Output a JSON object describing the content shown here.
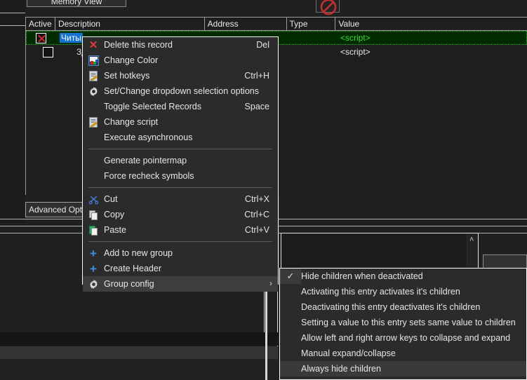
{
  "window": {
    "toolbar": {
      "memory_view_label": "Memory View",
      "stop_icon": "prohibition-icon",
      "grip_icon": "drag-grip-icon"
    },
    "advanced_options_label": "Advanced Opt",
    "scroll_up_glyph": "˄"
  },
  "cheat_table": {
    "columns": [
      "Active",
      "Description",
      "Address",
      "Type",
      "Value"
    ],
    "rows": [
      {
        "active": "x",
        "description": "Читы",
        "description_selected": true,
        "address": "",
        "type": "",
        "value": "<script>",
        "value_color": "green",
        "selected": true,
        "indent": false
      },
      {
        "active": "",
        "description": "Здор",
        "description_selected": false,
        "address": "",
        "type": "",
        "value": "<script>",
        "value_color": "white",
        "selected": false,
        "indent": true
      }
    ]
  },
  "context_menu": {
    "items": [
      {
        "icon": "delete-x-icon",
        "label": "Delete this record",
        "accel": "Del",
        "type": "item"
      },
      {
        "icon": "color-palette-icon",
        "label": "Change Color",
        "accel": "",
        "type": "item"
      },
      {
        "icon": "script-edit-icon",
        "label": "Set hotkeys",
        "accel": "Ctrl+H",
        "type": "item"
      },
      {
        "icon": "gear-icon",
        "label": "Set/Change dropdown selection options",
        "accel": "",
        "type": "item"
      },
      {
        "icon": "",
        "label": "Toggle Selected Records",
        "accel": "Space",
        "type": "item"
      },
      {
        "icon": "script-edit-icon",
        "label": "Change script",
        "accel": "",
        "type": "item"
      },
      {
        "icon": "",
        "label": "Execute asynchronous",
        "accel": "",
        "type": "item"
      },
      {
        "type": "separator"
      },
      {
        "icon": "",
        "label": "Generate pointermap",
        "accel": "",
        "type": "item"
      },
      {
        "icon": "",
        "label": "Force recheck symbols",
        "accel": "",
        "type": "item"
      },
      {
        "type": "separator"
      },
      {
        "icon": "cut-scissors-icon",
        "label": "Cut",
        "accel": "Ctrl+X",
        "type": "item"
      },
      {
        "icon": "copy-icon",
        "label": "Copy",
        "accel": "Ctrl+C",
        "type": "item"
      },
      {
        "icon": "paste-icon",
        "label": "Paste",
        "accel": "Ctrl+V",
        "type": "item"
      },
      {
        "type": "separator"
      },
      {
        "icon": "plus-icon",
        "label": "Add to new group",
        "accel": "",
        "type": "item"
      },
      {
        "icon": "plus-icon",
        "label": "Create Header",
        "accel": "",
        "type": "item"
      },
      {
        "icon": "gear-icon",
        "label": "Group config",
        "accel": "",
        "type": "submenu",
        "highlighted": true,
        "arrow": "›"
      }
    ]
  },
  "submenu": {
    "items": [
      {
        "label": "Hide children when deactivated",
        "checked": true,
        "highlighted": false
      },
      {
        "label": "Activating this entry activates it's children",
        "checked": false,
        "highlighted": false
      },
      {
        "label": "Deactivating this entry deactivates it's children",
        "checked": false,
        "highlighted": false
      },
      {
        "label": "Setting a value to this entry sets same value to children",
        "checked": false,
        "highlighted": false
      },
      {
        "label": "Allow left and right arrow keys to collapse and expand",
        "checked": false,
        "highlighted": false
      },
      {
        "label": "Manual expand/collapse",
        "checked": false,
        "highlighted": false
      },
      {
        "label": "Always hide children",
        "checked": false,
        "highlighted": true
      }
    ],
    "check_glyph": "✓"
  },
  "colors": {
    "menu_bg": "#2b2b2b",
    "menu_highlight": "#3d3d3d",
    "selected_row_bg": "#002c00",
    "selection_blue": "#1673d1",
    "value_green": "#3ddb3d",
    "accent_blue": "#3c8fe0",
    "danger_red": "#e23b3b"
  }
}
